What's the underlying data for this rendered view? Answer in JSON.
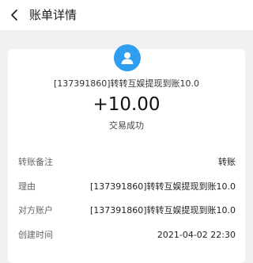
{
  "header": {
    "title": "账单详情"
  },
  "transaction": {
    "memo": "[137391860]转转互娱提现到账10.0",
    "amount": "+10.00",
    "status": "交易成功"
  },
  "details": [
    {
      "label": "转账备注",
      "value": "转账"
    },
    {
      "label": "理由",
      "value": "[137391860]转转互娱提现到账10.0"
    },
    {
      "label": "对方账户",
      "value": "[137391860]转转互娱提现到账10.0"
    },
    {
      "label": "创建时间",
      "value": "2021-04-02 22:30"
    }
  ],
  "icons": {
    "back": "chevron-left-icon",
    "avatar": "user-avatar-icon"
  },
  "colors": {
    "accent": "#2f9df0",
    "background": "#f1f1f3"
  }
}
